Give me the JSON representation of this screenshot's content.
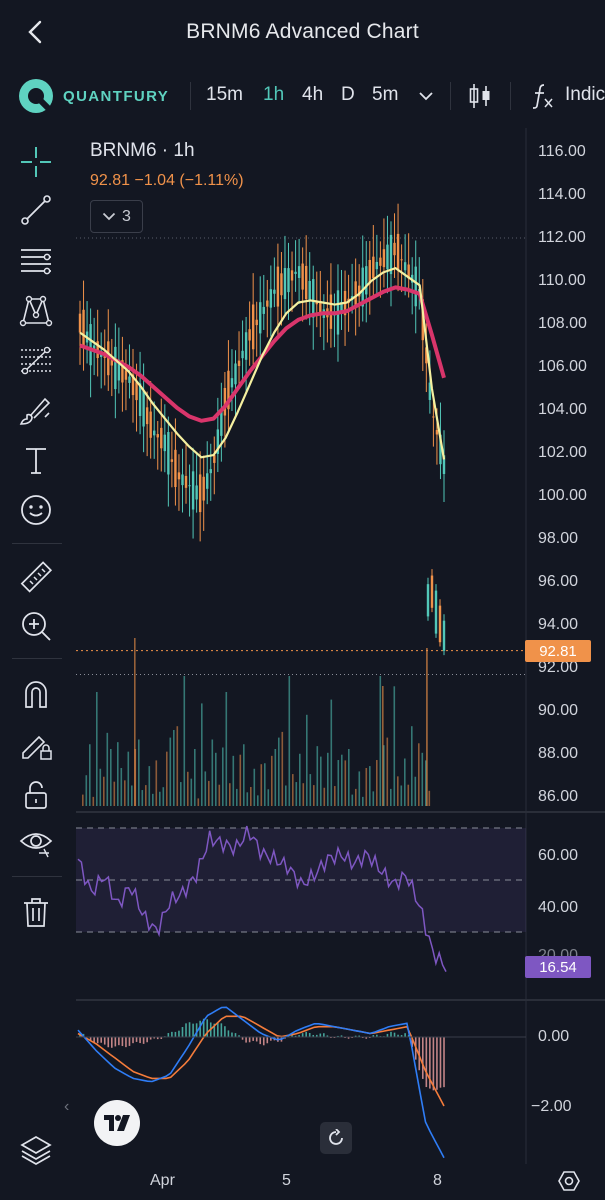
{
  "header": {
    "title": "BRNM6 Advanced Chart"
  },
  "toolbar": {
    "brand": "QUANTFURY",
    "timeframes": [
      "15m",
      "1h",
      "4h",
      "D",
      "5m"
    ],
    "active_timeframe": "1h",
    "indicators_label": "Indic"
  },
  "legend": {
    "symbol_interval": "BRNM6 · 1h",
    "price_change": "92.81  −1.04 (−1.11%)",
    "collapse_count": "3"
  },
  "left_tools": [
    "crosshair-icon",
    "trend-line-icon",
    "horizontal-lines-icon",
    "pattern-icon",
    "fib-icon",
    "brush-icon",
    "text-icon",
    "emoji-icon",
    "ruler-icon",
    "zoom-in-icon",
    "magnet-icon",
    "lock-drawing-icon",
    "unlock-icon",
    "eye-icon",
    "trash-icon"
  ],
  "price_axis": {
    "labels": [
      "116.00",
      "114.00",
      "112.00",
      "110.00",
      "108.00",
      "106.00",
      "104.00",
      "102.00",
      "100.00",
      "98.00",
      "96.00",
      "94.00",
      "92.00",
      "90.00",
      "88.00",
      "86.00"
    ],
    "current_price": "92.81"
  },
  "rsi_axis": {
    "labels": [
      "60.00",
      "40.00",
      "20.00"
    ],
    "current": "16.54"
  },
  "macd_axis": {
    "labels": [
      "0.00",
      "−2.00"
    ]
  },
  "date_axis": {
    "labels": [
      "Apr",
      "5",
      "8"
    ]
  },
  "colors": {
    "background": "#131722",
    "candle_up": "#52c7b8",
    "candle_down": "#f0924a",
    "ma_fast": "#f5f0a0",
    "ma_slow": "#d9356b",
    "rsi": "#7e57c2",
    "macd_line": "#2f7df6",
    "signal_line": "#f57c3b"
  },
  "chart_data": [
    {
      "type": "candlestick",
      "series": [
        {
          "values": [
            108.0,
            107.0,
            106.5,
            106.0,
            105.5,
            104.5,
            103.0,
            102.5,
            101.0,
            100.5,
            100.0,
            101.5,
            104.5,
            106.0,
            107.5,
            108.5,
            109.5,
            110.0,
            110.5,
            109.5,
            108.5,
            108.5,
            109.0,
            109.5,
            110.5,
            111.0,
            111.5,
            110.5,
            109.5,
            104.0,
            101.5
          ]
        },
        {
          "values": [
            107.6,
            107.2,
            106.8,
            106.3,
            105.8,
            105.1,
            104.3,
            103.6,
            102.9,
            102.3,
            101.8,
            101.9,
            102.7,
            103.9,
            105.2,
            106.5,
            107.6,
            108.5,
            109.0,
            109.1,
            109.0,
            108.9,
            109.0,
            109.4,
            110.0,
            110.4,
            110.6,
            110.2,
            109.8,
            105.0,
            101.7
          ]
        },
        {
          "values": [
            107.0,
            106.8,
            106.6,
            106.3,
            106.0,
            105.6,
            105.1,
            104.6,
            104.1,
            103.7,
            103.5,
            103.6,
            104.2,
            105.0,
            105.8,
            106.5,
            107.2,
            107.8,
            108.2,
            108.4,
            108.5,
            108.5,
            108.6,
            108.9,
            109.2,
            109.5,
            109.7,
            109.6,
            109.4,
            107.5,
            105.5
          ]
        }
      ],
      "ylim": [
        86,
        117
      ]
    },
    {
      "type": "bar",
      "series": [
        {
          "values": [
            12,
            18,
            25,
            8,
            60,
            14,
            22,
            35,
            20,
            16,
            28,
            40,
            15,
            22,
            18,
            30,
            25,
            12,
            10,
            14,
            8,
            20,
            15,
            11,
            22,
            60,
            40,
            30,
            18,
            70
          ]
        }
      ]
    },
    {
      "type": "line",
      "series": [
        {
          "values": [
            58,
            45,
            52,
            40,
            48,
            36,
            30,
            42,
            45,
            52,
            66,
            64,
            62,
            69,
            60,
            58,
            55,
            48,
            52,
            58,
            60,
            56,
            60,
            54,
            48,
            52,
            40,
            22,
            16.54
          ]
        }
      ],
      "ylim": [
        0,
        80
      ]
    },
    {
      "type": "line",
      "series": [
        {
          "values": [
            0.2,
            -0.4,
            -0.9,
            -1.2,
            -1.3,
            -1.1,
            -0.3,
            0.6,
            0.9,
            0.5,
            0.1,
            -0.1,
            0.2,
            0.4,
            0.3,
            0.2,
            0.1,
            0.3,
            0.4,
            -2.5,
            -3.5
          ]
        },
        {
          "values": [
            0.1,
            -0.2,
            -0.6,
            -1.0,
            -1.2,
            -1.2,
            -0.7,
            0.1,
            0.6,
            0.6,
            0.3,
            0.0,
            0.1,
            0.3,
            0.3,
            0.2,
            0.1,
            0.2,
            0.3,
            -1.0,
            -2.0
          ]
        }
      ],
      "ylim": [
        -3.5,
        1.0
      ]
    }
  ]
}
